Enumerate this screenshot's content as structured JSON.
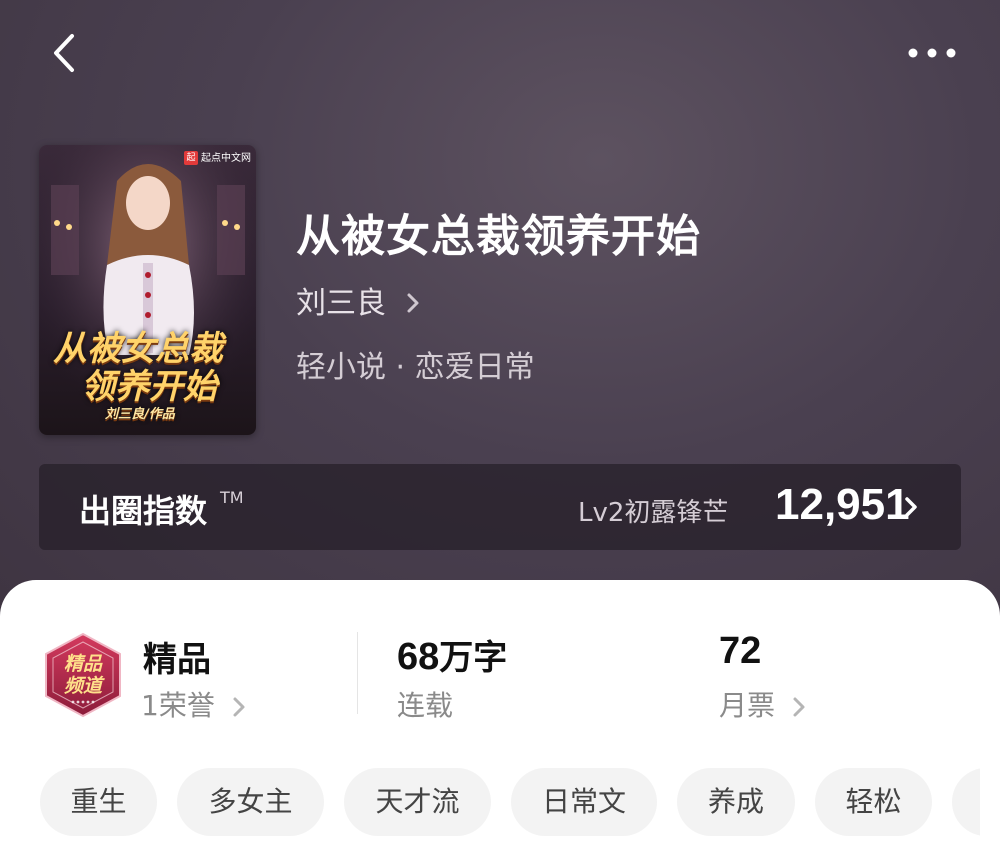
{
  "book": {
    "title": "从被女总裁领养开始",
    "author": "刘三良",
    "genre": "轻小说 · 恋爱日常"
  },
  "cover": {
    "publisher_logo": "起",
    "publisher": "起点中文网",
    "title_line1": "从被女总裁",
    "title_line2": "领养开始",
    "author_credit": "刘三良/作品"
  },
  "influence": {
    "label": "出圈指数",
    "trademark": "TM",
    "level": "Lv2初露锋芒",
    "score": "12,951"
  },
  "stats": {
    "quality_title": "精品",
    "quality_sub": "1荣誉",
    "badge_text_line1": "精品",
    "badge_text_line2": "频道",
    "words_value": "68",
    "words_unit": "万字",
    "status": "连载",
    "monthly_votes_value": "72",
    "monthly_votes_label": "月票"
  },
  "tags": [
    "重生",
    "多女主",
    "天才流",
    "日常文",
    "养成",
    "轻松"
  ],
  "colors": {
    "hero_bg": "#4a4050",
    "badge_red": "#b8284a",
    "tag_bg": "#f3f3f3"
  },
  "icons": {
    "back": "chevron-left-icon",
    "more": "more-horizontal-icon",
    "chevron": "chevron-right-icon"
  }
}
